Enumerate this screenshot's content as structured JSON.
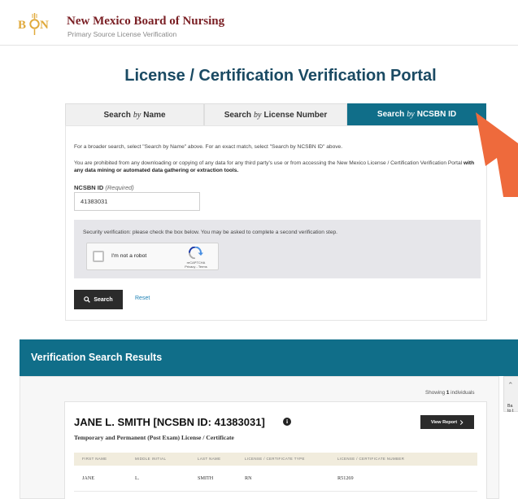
{
  "header": {
    "logo_text": "BON",
    "title": "New Mexico Board of Nursing",
    "subtitle": "Primary Source License Verification"
  },
  "portal_title": "License / Certification Verification Portal",
  "tabs": [
    {
      "pre": "Search",
      "by": "by",
      "post": "Name",
      "active": false
    },
    {
      "pre": "Search",
      "by": "by",
      "post": "License Number",
      "active": false
    },
    {
      "pre": "Search",
      "by": "by",
      "post": "NCSBN ID",
      "active": true
    }
  ],
  "form": {
    "hint": "For a broader search, select \"Search by Name\" above. For an exact match, select \"Search by NCSBN ID\" above.",
    "warning_pre": "You are prohibited from any downloading or copying of any data for any third party's use or from accessing the New Mexico License / Certification Verification Portal",
    "warning_bold": "with any data mining or automated data gathering or extraction tools.",
    "field_label": "NCSBN ID",
    "field_required": "(Required)",
    "field_value": "41383031",
    "security_text": "Security verification: please check the box below. You may be asked to complete a second verification step.",
    "captcha_label": "I'm not a robot",
    "captcha_brand": "reCAPTCHA",
    "captcha_links": "Privacy - Terms",
    "search_label": "Search",
    "reset_label": "Reset"
  },
  "results": {
    "title": "Verification Search Results",
    "showing_pre": "Showing",
    "showing_count": "1",
    "showing_post": "individuals",
    "side_tab_line1": "Ba",
    "side_tab_line2": "to t",
    "person_name": "JANE L. SMITH [NCSBN ID: 41383031]",
    "info_glyph": "i",
    "view_report_label": "View Report",
    "license_type": "Temporary and Permanent (Post Exam) License / Certificate",
    "columns": [
      "FIRST NAME",
      "MIDDLE INITIAL",
      "LAST NAME",
      "LICENSE / CERTIFICATE TYPE",
      "LICENSE / CERTIFICATE NUMBER"
    ],
    "row": [
      "JANE",
      "L.",
      "SMITH",
      "RN",
      "R51269"
    ]
  },
  "colors": {
    "brand": "#7a1f24",
    "accent": "#106e89",
    "title": "#1a4a63",
    "arrow": "#ee6a3c",
    "logo_gold": "#e0a93b"
  },
  "icons": {
    "search": "search-icon",
    "chevron": "chevron-right-icon",
    "info": "info-icon",
    "arrow": "callout-arrow-icon",
    "up": "chevron-up-icon"
  }
}
